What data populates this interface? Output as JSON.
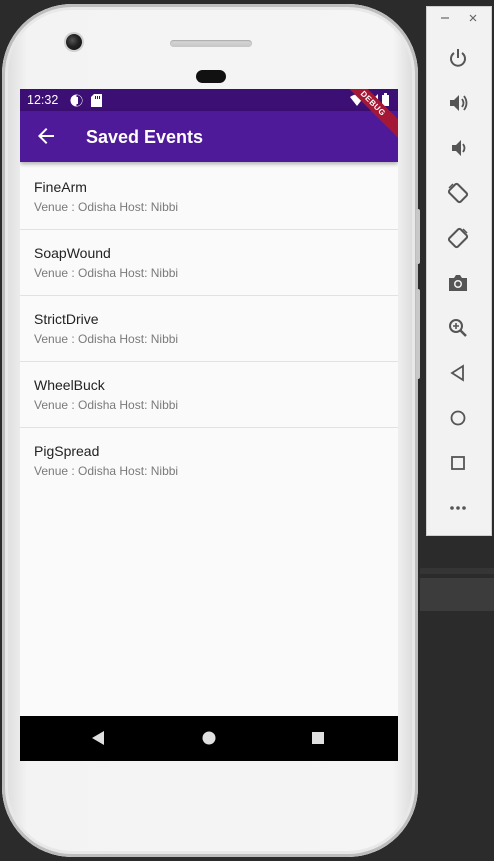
{
  "status_bar": {
    "time": "12:32"
  },
  "app_bar": {
    "title": "Saved Events",
    "back_icon": "arrow-back-icon",
    "debug_banner": "DEBUG"
  },
  "events": [
    {
      "name": "FineArm",
      "details": "Venue : Odisha  Host: Nibbi"
    },
    {
      "name": "SoapWound",
      "details": "Venue : Odisha  Host: Nibbi"
    },
    {
      "name": "StrictDrive",
      "details": "Venue : Odisha  Host: Nibbi"
    },
    {
      "name": "WheelBuck",
      "details": "Venue : Odisha  Host: Nibbi"
    },
    {
      "name": "PigSpread",
      "details": "Venue : Odisha  Host: Nibbi"
    }
  ],
  "emulator_controls": [
    "power-icon",
    "volume-up-icon",
    "volume-down-icon",
    "rotate-left-icon",
    "rotate-right-icon",
    "camera-icon",
    "zoom-icon",
    "back-icon",
    "home-icon",
    "overview-icon",
    "more-icon"
  ],
  "colors": {
    "status_bar": "#3c0f74",
    "app_bar": "#4f1a9a",
    "debug_banner": "#a41835",
    "list_background": "#fafafa"
  }
}
